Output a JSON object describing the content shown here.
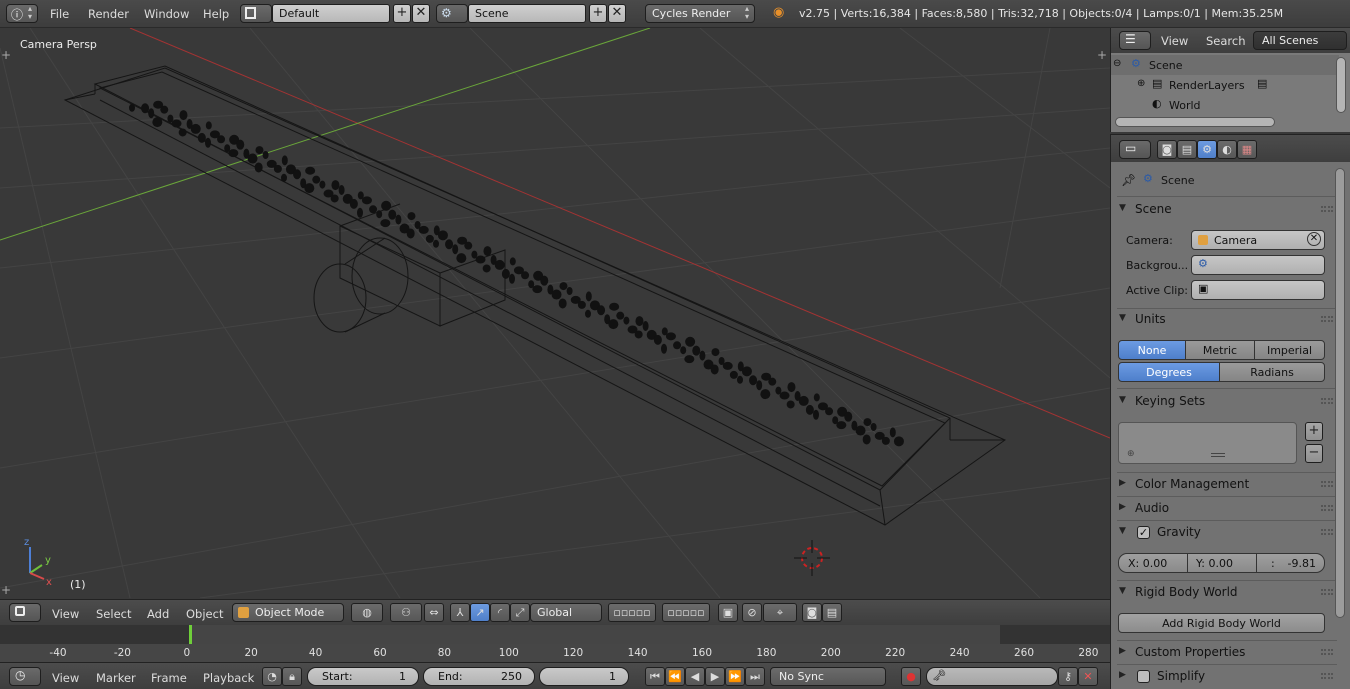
{
  "topbar": {
    "menus": [
      "File",
      "Render",
      "Window",
      "Help"
    ],
    "screen_layout": "Default",
    "scene": "Scene",
    "render_engine": "Cycles Render",
    "stats": "v2.75 | Verts:16,384 | Faces:8,580 | Tris:32,718 | Objects:0/4 | Lamps:0/1 | Mem:35.25M"
  },
  "viewport": {
    "label": "Camera Persp",
    "frame_label": "(1)",
    "axis_x": "x",
    "axis_y": "y",
    "axis_z": "z"
  },
  "view3d_header": {
    "menus": [
      "View",
      "Select",
      "Add",
      "Object"
    ],
    "mode": "Object Mode",
    "orientation": "Global"
  },
  "timeline": {
    "ticks": [
      "-40",
      "-20",
      "0",
      "20",
      "40",
      "60",
      "80",
      "100",
      "120",
      "140",
      "160",
      "180",
      "200",
      "220",
      "240",
      "260",
      "280"
    ],
    "current_frame_marker": 0
  },
  "timeline_header": {
    "menus": [
      "View",
      "Marker",
      "Frame",
      "Playback"
    ],
    "start_label": "Start:",
    "start_value": "1",
    "end_label": "End:",
    "end_value": "250",
    "current_frame": "1",
    "sync": "No Sync"
  },
  "outliner": {
    "menus": [
      "View",
      "Search"
    ],
    "filter": "All Scenes",
    "items": [
      "Scene",
      "RenderLayers",
      "World"
    ]
  },
  "properties": {
    "context_label": "Scene",
    "scene_panel": {
      "title": "Scene",
      "camera_label": "Camera:",
      "camera_value": "Camera",
      "background_label": "Backgrou...",
      "active_clip_label": "Active Clip:"
    },
    "units_panel": {
      "title": "Units",
      "systems": [
        "None",
        "Metric",
        "Imperial"
      ],
      "rotation": [
        "Degrees",
        "Radians"
      ]
    },
    "keying_sets_title": "Keying Sets",
    "color_management_title": "Color Management",
    "audio_title": "Audio",
    "gravity_panel": {
      "title": "Gravity",
      "x": "X: 0.00",
      "y": "Y:  0.00",
      "z_label": ":",
      "z_value": "-9.81"
    },
    "rigid_body_title": "Rigid Body World",
    "rigid_body_button": "Add Rigid Body World",
    "custom_properties_title": "Custom Properties",
    "simplify_title": "Simplify"
  },
  "colors": {
    "accent_blue": "#5b8bd6",
    "playhead_green": "#6fcf3a",
    "grid_line": "#454545",
    "x_axis_red": "#a33333",
    "y_axis_green": "#6aa63a"
  }
}
